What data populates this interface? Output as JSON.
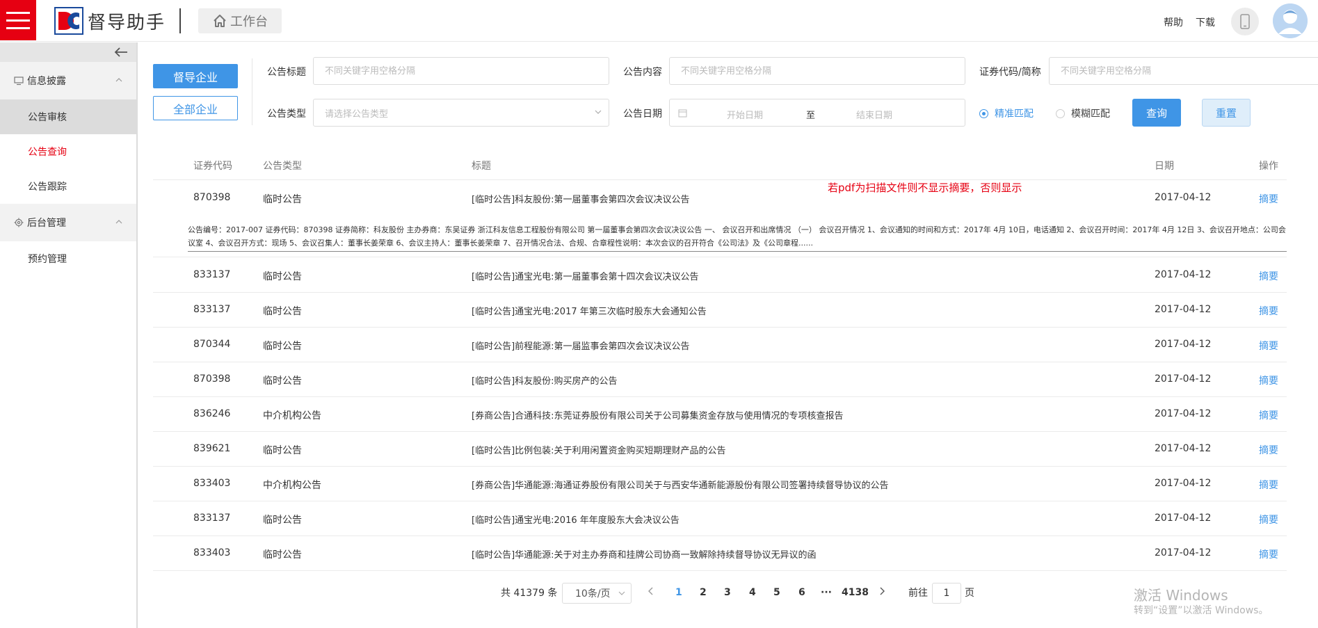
{
  "header": {
    "app_name": "督导助手",
    "workbench_label": "工作台",
    "help_label": "帮助",
    "download_label": "下载"
  },
  "sidebar": {
    "groups": [
      {
        "label": "信息披露",
        "icon": "monitor-icon",
        "items": [
          "公告审核",
          "公告查询",
          "公告跟踪"
        ]
      },
      {
        "label": "后台管理",
        "icon": "gear-icon",
        "items": [
          "预约管理"
        ]
      }
    ]
  },
  "filters": {
    "supervised_label": "督导企业",
    "all_label": "全部企业",
    "title_label": "公告标题",
    "title_placeholder": "不同关键字用空格分隔",
    "content_label": "公告内容",
    "content_placeholder": "不同关键字用空格分隔",
    "code_label": "证券代码/简称",
    "code_placeholder": "不同关键字用空格分隔",
    "type_label": "公告类型",
    "type_placeholder": "请选择公告类型",
    "date_label": "公告日期",
    "start_placeholder": "开始日期",
    "range_sep": "至",
    "end_placeholder": "结束日期",
    "exact_label": "精准匹配",
    "fuzzy_label": "模糊匹配",
    "query_label": "查询",
    "reset_label": "重置"
  },
  "table": {
    "headers": [
      "证券代码",
      "公告类型",
      "标题",
      "日期",
      "操作"
    ],
    "note": "若pdf为扫描文件则不显示摘要，否则显示",
    "abstract": "公告编号：2017-007 证券代码：870398 证券简称：科友股份 主办券商：东吴证券 浙江科友信息工程股份有限公司 第一届董事会第四次会议决议公告 一、 会议召开和出席情况 （一） 会议召开情况 1、会议通知的时间和方式：2017年 4月 10日，电话通知 2、会议召开时间：2017年 4月 12日 3、会议召开地点：公司会议室 4、会议召开方式：现场 5、会议召集人：董事长姜荣章 6、会议主持人：董事长姜荣章 7、召开情况合法、合规、合章程性说明：本次会议的召开符合《公司法》及《公司章程......",
    "rows": [
      {
        "code": "870398",
        "type": "临时公告",
        "title": "[临时公告]科友股份:第一届董事会第四次会议决议公告",
        "date": "2017-04-12",
        "action": "摘要"
      },
      {
        "code": "833137",
        "type": "临时公告",
        "title": "[临时公告]通宝光电:第一届董事会第十四次会议决议公告",
        "date": "2017-04-12",
        "action": "摘要"
      },
      {
        "code": "833137",
        "type": "临时公告",
        "title": "[临时公告]通宝光电:2017 年第三次临时股东大会通知公告",
        "date": "2017-04-12",
        "action": "摘要"
      },
      {
        "code": "870344",
        "type": "临时公告",
        "title": "[临时公告]前程能源:第一届监事会第四次会议决议公告",
        "date": "2017-04-12",
        "action": "摘要"
      },
      {
        "code": "870398",
        "type": "临时公告",
        "title": "[临时公告]科友股份:购买房产的公告",
        "date": "2017-04-12",
        "action": "摘要"
      },
      {
        "code": "836246",
        "type": "中介机构公告",
        "title": "[券商公告]合通科技:东莞证券股份有限公司关于公司募集资金存放与使用情况的专项核查报告",
        "date": "2017-04-12",
        "action": "摘要"
      },
      {
        "code": "839621",
        "type": "临时公告",
        "title": "[临时公告]比例包装:关于利用闲置资金购买短期理财产品的公告",
        "date": "2017-04-12",
        "action": "摘要"
      },
      {
        "code": "833403",
        "type": "中介机构公告",
        "title": "[券商公告]华通能源:海通证券股份有限公司关于与西安华通新能源股份有限公司签署持续督导协议的公告",
        "date": "2017-04-12",
        "action": "摘要"
      },
      {
        "code": "833137",
        "type": "临时公告",
        "title": "[临时公告]通宝光电:2016 年年度股东大会决议公告",
        "date": "2017-04-12",
        "action": "摘要"
      },
      {
        "code": "833403",
        "type": "临时公告",
        "title": "[临时公告]华通能源:关于对主办券商和挂牌公司协商一致解除持续督导协议无异议的函",
        "date": "2017-04-12",
        "action": "摘要"
      }
    ]
  },
  "pagination": {
    "total": "共 41379 条",
    "page_size": "10条/页",
    "pages": [
      "1",
      "2",
      "3",
      "4",
      "5",
      "6",
      "···",
      "4138"
    ],
    "current": "1",
    "goto_label": "前往",
    "goto_value": "1",
    "page_unit": "页"
  },
  "watermark": {
    "line1": "激活 Windows",
    "line2": "转到“设置”以激活 Windows。"
  },
  "colors": {
    "brand_red": "#e60012",
    "accent_blue": "#3f95e6"
  }
}
